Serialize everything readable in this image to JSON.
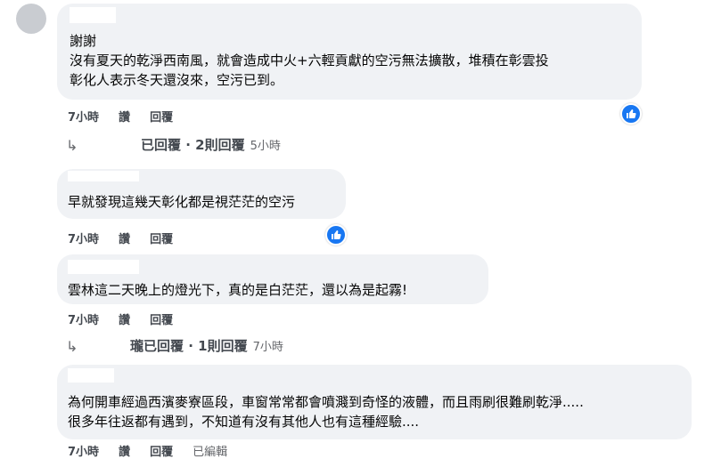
{
  "comments": [
    {
      "lines": [
        "謝謝",
        "沒有夏天的乾淨西南風，就會造成中火+六輕貢獻的空污無法擴散，堆積在彰雲投",
        "彰化人表示冬天還沒來，空污已到。"
      ],
      "time": "7小時",
      "like": "讚",
      "reply": "回覆",
      "reaction": "like-icon"
    },
    {
      "lines": [
        "早就發現這幾天彰化都是視茫茫的空污"
      ],
      "time": "7小時",
      "like": "讚",
      "reply": "回覆",
      "reaction": "like-icon"
    },
    {
      "lines": [
        "雲林這二天晚上的燈光下，真的是白茫茫，還以為是起霧!"
      ],
      "time": "7小時",
      "like": "讚",
      "reply": "回覆"
    },
    {
      "lines": [
        "為何開車經過西濱麥寮區段，車窗常常都會噴濺到奇怪的液體，而且雨刷很難刷乾淨.....",
        "很多年往返都有遇到，不知道有沒有其他人也有這種經驗...."
      ],
      "time": "7小時",
      "like": "讚",
      "reply": "回覆",
      "edited": "已編輯"
    }
  ],
  "reply_threads": [
    {
      "label": "已回覆 · 2則回覆",
      "time": "5小時"
    },
    {
      "label": "已回覆 · 1則回覆",
      "time": "7小時",
      "prefix": "瓏"
    }
  ],
  "colors": {
    "bubble": "#f0f2f5",
    "like_blue": "#1877f2",
    "meta": "#65676b"
  }
}
